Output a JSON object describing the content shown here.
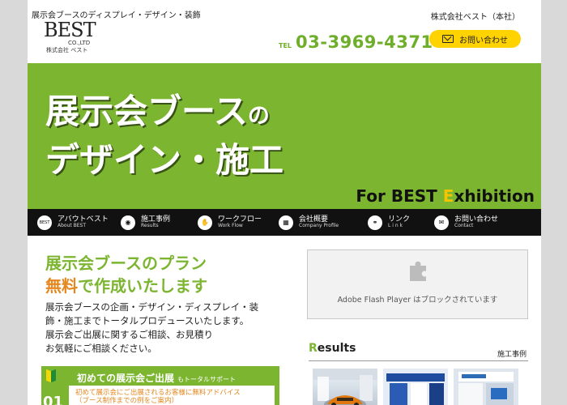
{
  "header": {
    "tagline": "展示会ブースのディスプレイ・デザイン・装飾",
    "logo_main": "BEST",
    "logo_co": "CO.,LTD",
    "logo_jp": "株式会社 ベスト",
    "company_name": "株式会社ベスト（本社）",
    "tel_label": "TEL",
    "tel_number": "03-3969-4371",
    "contact_label": "お問い合わせ",
    "contact_icon": "mail-icon"
  },
  "hero": {
    "line1": "展示会ブース",
    "line1_small": "の",
    "line2": "デザイン・施工",
    "sub_prefix": "For BEST ",
    "sub_E": "E",
    "sub_suffix": "xhibition"
  },
  "nav": {
    "items": [
      {
        "jp": "アバウトベスト",
        "en": "About BEST",
        "icon": "best-logo-icon",
        "glyph": "BEST"
      },
      {
        "jp": "施工事例",
        "en": "Results",
        "icon": "camera-icon",
        "glyph": "◉"
      },
      {
        "jp": "ワークフロー",
        "en": "Work Flow",
        "icon": "hand-icon",
        "glyph": "✋"
      },
      {
        "jp": "会社概要",
        "en": "Company Profile",
        "icon": "building-icon",
        "glyph": "▦"
      },
      {
        "jp": "リンク",
        "en": "L i n k",
        "icon": "link-icon",
        "glyph": "⚭"
      },
      {
        "jp": "お問い合わせ",
        "en": "Contact",
        "icon": "mail-icon",
        "glyph": "✉"
      }
    ]
  },
  "intro": {
    "heading1": "展示会ブースのプラン",
    "heading2_highlight": "無料",
    "heading2_rest": "で作成いたします",
    "body": [
      "展示会ブースの企画・デザイン・ディスプレイ・装",
      "飾・施工までトータルプロデュースいたします。",
      "展示会ご出展に関するご相談、お見積り",
      "お気軽にご相談ください。"
    ]
  },
  "box01": {
    "title": "初めての展示会ご出展",
    "title_small": "もトータルサポート",
    "number": "01",
    "lines": [
      "初めて展示会にご出展されるお客様に無料アドバイス",
      "（ブース制作までの例をご案内）"
    ]
  },
  "flash": {
    "message": "Adobe Flash Player はブロックされています"
  },
  "results": {
    "title_R": "R",
    "title_rest": "esults",
    "link_label": "施工事例"
  },
  "colors": {
    "green": "#7cb530",
    "orange": "#e5871e",
    "yellow": "#ffd300",
    "nav_bg": "#111111"
  }
}
